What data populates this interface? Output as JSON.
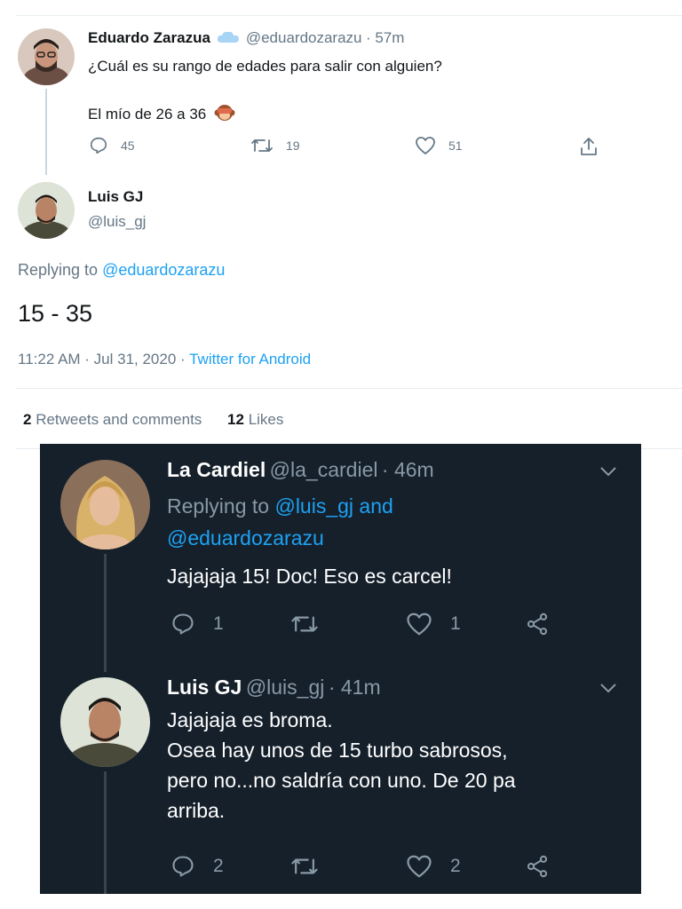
{
  "original_tweet": {
    "author_name": "Eduardo Zarazua",
    "handle": "@eduardozarazu",
    "time": "· 57m",
    "text_line1": "¿Cuál es su rango de edades para salir con alguien?",
    "text_line2": "El mío de 26 a 36",
    "emoji": "see-no-evil-monkey-icon",
    "actions": {
      "replies": "45",
      "retweets": "19",
      "likes": "51"
    }
  },
  "reply_tweet": {
    "author_name": "Luis GJ",
    "handle": "@luis_gj",
    "replying_prefix": "Replying to",
    "replying_to": "@eduardozarazu",
    "text": "15 - 35",
    "timestamp": "11:22 AM · Jul 31, 2020 ·",
    "source": "Twitter for Android"
  },
  "engagement": {
    "retweets_count": "2",
    "retweets_label": "Retweets and comments",
    "likes_count": "12",
    "likes_label": "Likes"
  },
  "screenshot_replies": [
    {
      "author_name": "La Cardiel",
      "handle": "@la_cardiel",
      "time": "· 46m",
      "replying_prefix": "Replying to",
      "replying_to_1": "@luis_gj and",
      "replying_to_2": "@eduardozarazu",
      "text_lines": [
        "Jajajaja 15! Doc! Eso es carcel!"
      ],
      "replies": "1",
      "likes": "1"
    },
    {
      "author_name": "Luis GJ",
      "handle": "@luis_gj",
      "time": "· 41m",
      "text_lines": [
        "Jajajaja es broma.",
        "Osea hay unos de 15 turbo sabrosos,",
        "pero no...no saldría con uno. De 20 pa",
        "arriba."
      ],
      "replies": "2",
      "likes": "2"
    }
  ],
  "colors": {
    "accent": "#1da1f2",
    "dark_bg": "#15202b",
    "muted": "#657786"
  }
}
